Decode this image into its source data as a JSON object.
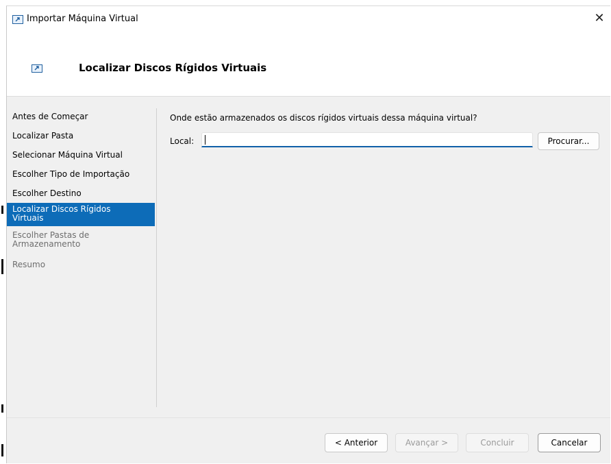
{
  "window": {
    "title": "Importar Máquina Virtual",
    "close_label": "✕"
  },
  "header": {
    "title": "Localizar Discos Rígidos Virtuais"
  },
  "nav": {
    "items": [
      {
        "label": "Antes de Começar",
        "state": "normal"
      },
      {
        "label": "Localizar Pasta",
        "state": "normal"
      },
      {
        "label": "Selecionar Máquina Virtual",
        "state": "normal"
      },
      {
        "label": "Escolher Tipo de Importação",
        "state": "normal"
      },
      {
        "label": "Escolher Destino",
        "state": "normal"
      },
      {
        "label": "Localizar Discos Rígidos Virtuais",
        "state": "selected"
      },
      {
        "label": "Escolher Pastas de Armazenamento",
        "state": "disabled"
      },
      {
        "label": "Resumo",
        "state": "disabled"
      }
    ]
  },
  "main": {
    "question": "Onde estão armazenados os discos rígidos virtuais dessa máquina virtual?",
    "local_label": "Local:",
    "local_value": "",
    "browse_label": "Procurar..."
  },
  "footer": {
    "previous_label": "< Anterior",
    "next_label": "Avançar >",
    "finish_label": "Concluir",
    "cancel_label": "Cancelar"
  },
  "colors": {
    "selection": "#0d6cb8",
    "input_underline": "#0f5fa8",
    "disabled_text": "#6d6d6d"
  }
}
